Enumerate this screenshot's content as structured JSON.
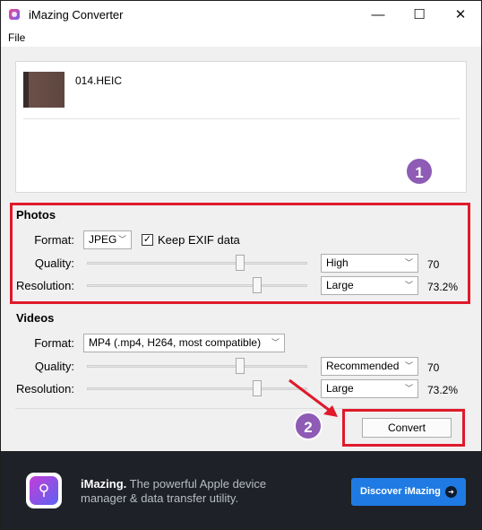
{
  "window": {
    "title": "iMazing Converter",
    "controls": {
      "minimize": "—",
      "maximize": "☐",
      "close": "✕"
    }
  },
  "menu": {
    "items": [
      "File"
    ]
  },
  "files": [
    {
      "name": "014.HEIC"
    }
  ],
  "badges": {
    "one": "1",
    "two": "2"
  },
  "photos": {
    "title": "Photos",
    "format_label": "Format:",
    "format_value": "JPEG",
    "keep_exif_label": "Keep EXIF data",
    "keep_exif_checked": true,
    "quality_label": "Quality:",
    "quality_value": "High",
    "quality_number": "70",
    "quality_level": 0.7,
    "resolution_label": "Resolution:",
    "resolution_value": "Large",
    "resolution_percent": "73.2%",
    "resolution_level": 0.732
  },
  "videos": {
    "title": "Videos",
    "format_label": "Format:",
    "format_value": "MP4 (.mp4, H264, most compatible)",
    "quality_label": "Quality:",
    "quality_value": "Recommended",
    "quality_number": "70",
    "quality_level": 0.7,
    "resolution_label": "Resolution:",
    "resolution_value": "Large",
    "resolution_percent": "73.2%",
    "resolution_level": 0.732
  },
  "actions": {
    "convert": "Convert"
  },
  "banner": {
    "brand": "iMazing.",
    "text": " The powerful Apple device manager & data transfer utility.",
    "button": "Discover iMazing",
    "button_icon": "➜"
  },
  "colors": {
    "highlight": "#e0192b",
    "badge": "#8e5bb5",
    "banner_bg": "#1e2127",
    "discover": "#1f7be3"
  }
}
